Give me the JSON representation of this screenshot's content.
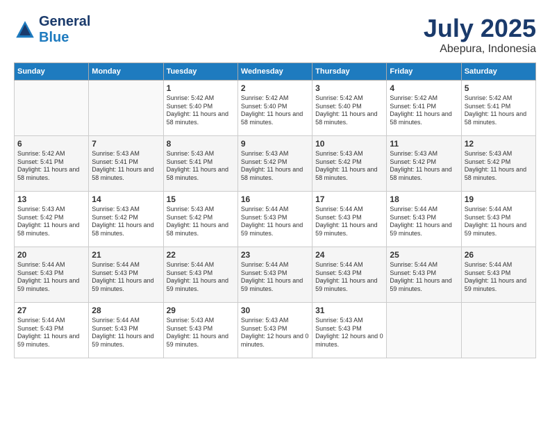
{
  "header": {
    "logo_line1": "General",
    "logo_line2": "Blue",
    "month": "July 2025",
    "location": "Abepura, Indonesia"
  },
  "weekdays": [
    "Sunday",
    "Monday",
    "Tuesday",
    "Wednesday",
    "Thursday",
    "Friday",
    "Saturday"
  ],
  "weeks": [
    [
      {
        "day": "",
        "info": ""
      },
      {
        "day": "",
        "info": ""
      },
      {
        "day": "1",
        "info": "Sunrise: 5:42 AM\nSunset: 5:40 PM\nDaylight: 11 hours and 58 minutes."
      },
      {
        "day": "2",
        "info": "Sunrise: 5:42 AM\nSunset: 5:40 PM\nDaylight: 11 hours and 58 minutes."
      },
      {
        "day": "3",
        "info": "Sunrise: 5:42 AM\nSunset: 5:40 PM\nDaylight: 11 hours and 58 minutes."
      },
      {
        "day": "4",
        "info": "Sunrise: 5:42 AM\nSunset: 5:41 PM\nDaylight: 11 hours and 58 minutes."
      },
      {
        "day": "5",
        "info": "Sunrise: 5:42 AM\nSunset: 5:41 PM\nDaylight: 11 hours and 58 minutes."
      }
    ],
    [
      {
        "day": "6",
        "info": "Sunrise: 5:42 AM\nSunset: 5:41 PM\nDaylight: 11 hours and 58 minutes."
      },
      {
        "day": "7",
        "info": "Sunrise: 5:43 AM\nSunset: 5:41 PM\nDaylight: 11 hours and 58 minutes."
      },
      {
        "day": "8",
        "info": "Sunrise: 5:43 AM\nSunset: 5:41 PM\nDaylight: 11 hours and 58 minutes."
      },
      {
        "day": "9",
        "info": "Sunrise: 5:43 AM\nSunset: 5:42 PM\nDaylight: 11 hours and 58 minutes."
      },
      {
        "day": "10",
        "info": "Sunrise: 5:43 AM\nSunset: 5:42 PM\nDaylight: 11 hours and 58 minutes."
      },
      {
        "day": "11",
        "info": "Sunrise: 5:43 AM\nSunset: 5:42 PM\nDaylight: 11 hours and 58 minutes."
      },
      {
        "day": "12",
        "info": "Sunrise: 5:43 AM\nSunset: 5:42 PM\nDaylight: 11 hours and 58 minutes."
      }
    ],
    [
      {
        "day": "13",
        "info": "Sunrise: 5:43 AM\nSunset: 5:42 PM\nDaylight: 11 hours and 58 minutes."
      },
      {
        "day": "14",
        "info": "Sunrise: 5:43 AM\nSunset: 5:42 PM\nDaylight: 11 hours and 58 minutes."
      },
      {
        "day": "15",
        "info": "Sunrise: 5:43 AM\nSunset: 5:42 PM\nDaylight: 11 hours and 58 minutes."
      },
      {
        "day": "16",
        "info": "Sunrise: 5:44 AM\nSunset: 5:43 PM\nDaylight: 11 hours and 59 minutes."
      },
      {
        "day": "17",
        "info": "Sunrise: 5:44 AM\nSunset: 5:43 PM\nDaylight: 11 hours and 59 minutes."
      },
      {
        "day": "18",
        "info": "Sunrise: 5:44 AM\nSunset: 5:43 PM\nDaylight: 11 hours and 59 minutes."
      },
      {
        "day": "19",
        "info": "Sunrise: 5:44 AM\nSunset: 5:43 PM\nDaylight: 11 hours and 59 minutes."
      }
    ],
    [
      {
        "day": "20",
        "info": "Sunrise: 5:44 AM\nSunset: 5:43 PM\nDaylight: 11 hours and 59 minutes."
      },
      {
        "day": "21",
        "info": "Sunrise: 5:44 AM\nSunset: 5:43 PM\nDaylight: 11 hours and 59 minutes."
      },
      {
        "day": "22",
        "info": "Sunrise: 5:44 AM\nSunset: 5:43 PM\nDaylight: 11 hours and 59 minutes."
      },
      {
        "day": "23",
        "info": "Sunrise: 5:44 AM\nSunset: 5:43 PM\nDaylight: 11 hours and 59 minutes."
      },
      {
        "day": "24",
        "info": "Sunrise: 5:44 AM\nSunset: 5:43 PM\nDaylight: 11 hours and 59 minutes."
      },
      {
        "day": "25",
        "info": "Sunrise: 5:44 AM\nSunset: 5:43 PM\nDaylight: 11 hours and 59 minutes."
      },
      {
        "day": "26",
        "info": "Sunrise: 5:44 AM\nSunset: 5:43 PM\nDaylight: 11 hours and 59 minutes."
      }
    ],
    [
      {
        "day": "27",
        "info": "Sunrise: 5:44 AM\nSunset: 5:43 PM\nDaylight: 11 hours and 59 minutes."
      },
      {
        "day": "28",
        "info": "Sunrise: 5:44 AM\nSunset: 5:43 PM\nDaylight: 11 hours and 59 minutes."
      },
      {
        "day": "29",
        "info": "Sunrise: 5:43 AM\nSunset: 5:43 PM\nDaylight: 11 hours and 59 minutes."
      },
      {
        "day": "30",
        "info": "Sunrise: 5:43 AM\nSunset: 5:43 PM\nDaylight: 12 hours and 0 minutes."
      },
      {
        "day": "31",
        "info": "Sunrise: 5:43 AM\nSunset: 5:43 PM\nDaylight: 12 hours and 0 minutes."
      },
      {
        "day": "",
        "info": ""
      },
      {
        "day": "",
        "info": ""
      }
    ]
  ]
}
